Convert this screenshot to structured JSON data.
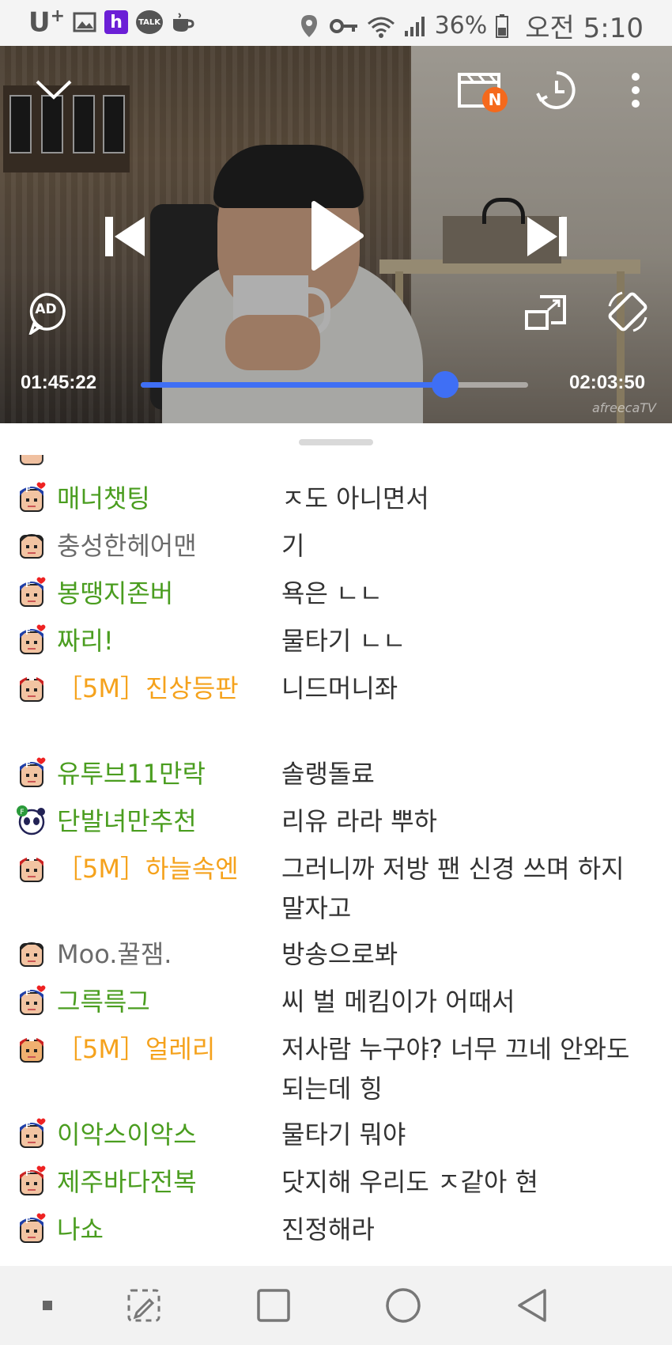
{
  "status_bar": {
    "carrier": "U",
    "carrier_sup": "+",
    "talk_label": "TALK",
    "h_label": "h",
    "battery_percent": "36%",
    "time": "오전 5:10"
  },
  "player": {
    "current_time": "01:45:22",
    "total_time": "02:03:50",
    "progress_fraction": 0.785,
    "new_badge": "N",
    "ad_label": "AD",
    "watermark": "afreecaTV",
    "accent_color": "#3f6ff5"
  },
  "chat": {
    "messages": [
      {
        "type": "fan",
        "avatar": "fan-avatar",
        "nick": "매너챗팅",
        "text": "ㅈ도 아니면서"
      },
      {
        "type": "plain",
        "avatar": "default-avatar",
        "nick": "충성한헤어맨",
        "text": "기"
      },
      {
        "type": "fan",
        "avatar": "fan-avatar",
        "nick": "봉땡지존버",
        "text": "욕은 ㄴㄴ"
      },
      {
        "type": "fan",
        "avatar": "fan-avatar",
        "nick": "짜리!",
        "text": "물타기 ㄴㄴ"
      },
      {
        "type": "vip",
        "avatar": "manager-avatar",
        "nick": "［5M］진상등판",
        "text": "니드머니좌"
      },
      {
        "type": "fan",
        "avatar": "fan-avatar",
        "nick": "유투브11만락",
        "text": "솔랭돌료"
      },
      {
        "type": "fan",
        "avatar": "panda-avatar",
        "nick": "단발녀만추천",
        "text": "리유 라라 뿌하"
      },
      {
        "type": "vip",
        "avatar": "manager-avatar",
        "nick": "［5M］하늘속엔",
        "text": "그러니까 저방 팬 신경 쓰며 하지 말자고"
      },
      {
        "type": "plain",
        "avatar": "default-avatar",
        "nick": "Moo.꿀잼.",
        "text": "방송으로봐"
      },
      {
        "type": "fan",
        "avatar": "fan-avatar",
        "nick": "그륵륵그",
        "text": "씨 벌 메킴이가 어때서"
      },
      {
        "type": "vip",
        "avatar": "manager-red-avatar",
        "nick": "［5M］얼레리",
        "text": "저사람 누구야? 너무 끄네 안와도 되는데 힝"
      },
      {
        "type": "fan",
        "avatar": "fan-avatar",
        "nick": "이악스이악스",
        "text": "물타기 뭐야"
      },
      {
        "type": "fan",
        "avatar": "fan-red-avatar",
        "nick": "제주바다전복",
        "text": "닷지해 우리도 ㅈ같아 현"
      },
      {
        "type": "fan",
        "avatar": "fan-avatar",
        "nick": "나쇼",
        "text": "진정해라"
      }
    ]
  },
  "colors": {
    "fan_nick": "#4a9d1f",
    "vip_nick": "#f5a21c",
    "plain_nick": "#6b6b6b"
  }
}
